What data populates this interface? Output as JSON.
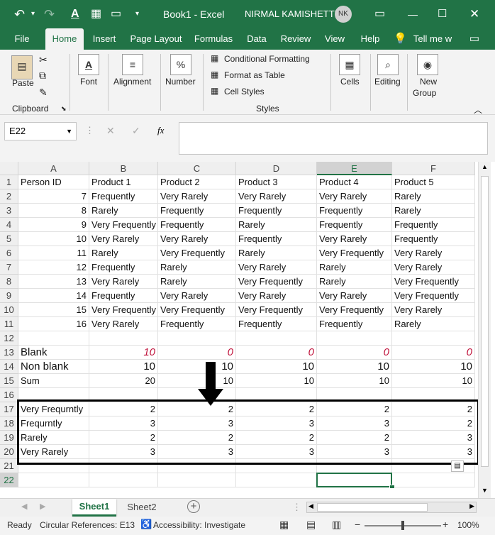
{
  "titlebar": {
    "doc_title": "Book1  -  Excel",
    "user": "NIRMAL KAMISHETTY",
    "initials": "NK"
  },
  "tabs": [
    "File",
    "Home",
    "Insert",
    "Page Layout",
    "Formulas",
    "Data",
    "Review",
    "View",
    "Help",
    "Tell me w"
  ],
  "ribbon": {
    "paste": "Paste",
    "clipboard": "Clipboard",
    "font": "Font",
    "alignment": "Alignment",
    "number": "Number",
    "cond_format": "Conditional Formatting",
    "format_table": "Format as Table",
    "cell_styles": "Cell Styles",
    "styles": "Styles",
    "cells": "Cells",
    "editing": "Editing",
    "new_group_1": "New",
    "new_group_2": "Group"
  },
  "formula_bar": {
    "name_box": "E22",
    "fx": "fx",
    "value": ""
  },
  "columns": [
    "A",
    "B",
    "C",
    "D",
    "E",
    "F"
  ],
  "rows": [
    [
      "1",
      "Person ID",
      "Product 1",
      "Product 2",
      "Product 3",
      "Product 4",
      "Product 5"
    ],
    [
      "2",
      "7",
      "Frequently",
      "Very Rarely",
      "Very Rarely",
      "Very Rarely",
      "Rarely"
    ],
    [
      "3",
      "8",
      "Rarely",
      "Frequently",
      "Frequently",
      "Frequently",
      "Rarely"
    ],
    [
      "4",
      "9",
      "Very Frequently",
      "Frequently",
      "Rarely",
      "Frequently",
      "Frequently"
    ],
    [
      "5",
      "10",
      "Very Rarely",
      "Very Rarely",
      "Frequently",
      "Very Rarely",
      "Frequently"
    ],
    [
      "6",
      "11",
      "Rarely",
      "Very Frequently",
      "Rarely",
      "Very Frequently",
      "Very Rarely"
    ],
    [
      "7",
      "12",
      "Frequently",
      "Rarely",
      "Very Rarely",
      "Rarely",
      "Very Rarely"
    ],
    [
      "8",
      "13",
      "Very Rarely",
      "Rarely",
      "Very Frequently",
      "Rarely",
      "Very Frequently"
    ],
    [
      "9",
      "14",
      "Frequently",
      "Very Rarely",
      "Very Rarely",
      "Very Rarely",
      "Very Frequently"
    ],
    [
      "10",
      "15",
      "Very Frequently",
      "Very Frequently",
      "Very Frequently",
      "Very Frequently",
      "Very Rarely"
    ],
    [
      "11",
      "16",
      "Very Rarely",
      "Frequently",
      "Frequently",
      "Frequently",
      "Rarely"
    ],
    [
      "12",
      "",
      "",
      "",
      "",
      "",
      ""
    ],
    [
      "13",
      "Blank",
      "10",
      "0",
      "0",
      "0",
      "0"
    ],
    [
      "14",
      "Non blank",
      "10",
      "10",
      "10",
      "10",
      "10"
    ],
    [
      "15",
      "Sum",
      "20",
      "10",
      "10",
      "10",
      "10"
    ],
    [
      "16",
      "",
      "",
      "",
      "",
      "",
      ""
    ],
    [
      "17",
      "Very Frequrntly",
      "2",
      "2",
      "2",
      "2",
      "2"
    ],
    [
      "18",
      "Frequrntly",
      "3",
      "3",
      "3",
      "3",
      "2"
    ],
    [
      "19",
      "Rarely",
      "2",
      "2",
      "2",
      "2",
      "3"
    ],
    [
      "20",
      "Very Rarely",
      "3",
      "3",
      "3",
      "3",
      "3"
    ],
    [
      "21",
      "",
      "",
      "",
      "",
      "",
      ""
    ],
    [
      "22",
      "",
      "",
      "",
      "",
      "",
      ""
    ]
  ],
  "sheets": [
    "Sheet1",
    "Sheet2"
  ],
  "status": {
    "ready": "Ready",
    "circular": "Circular References: E13",
    "accessibility": "Accessibility: Investigate",
    "zoom": "100%"
  },
  "colors": {
    "excel_green": "#217346",
    "blank_red": "#c0143c"
  }
}
